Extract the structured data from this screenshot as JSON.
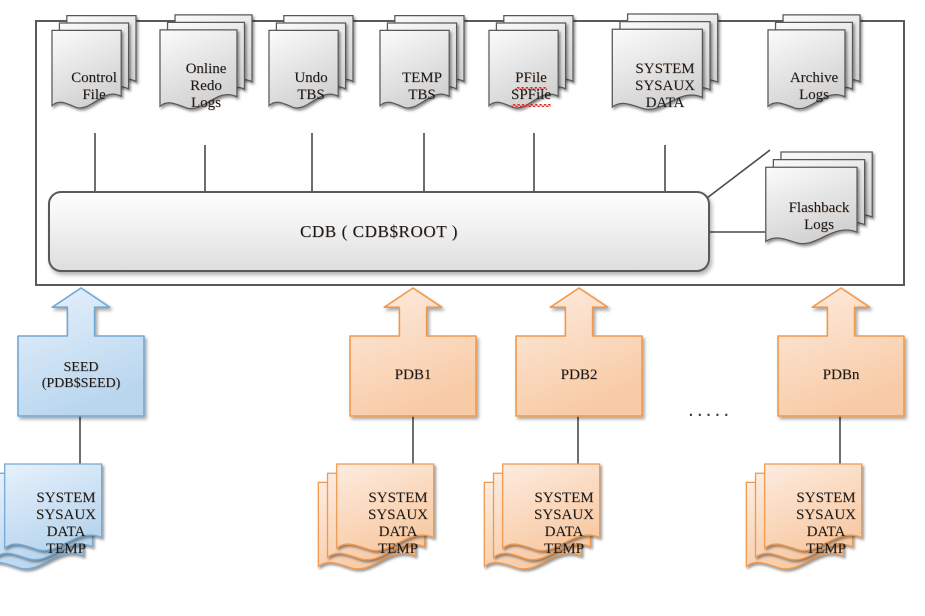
{
  "diagram": {
    "title": "Oracle Multitenant CDB Architecture",
    "colors": {
      "gray_fill_light": "#fbfbfb",
      "gray_fill_dark": "#d2d2d2",
      "gray_stroke": "#595959",
      "blue_fill_light": "#e8f1fb",
      "blue_fill_dark": "#b9d6ef",
      "blue_stroke": "#6fa8d6",
      "orange_fill_light": "#fdece0",
      "orange_fill_dark": "#f8cba6",
      "orange_stroke": "#f0994e",
      "container_stroke": "#5a5a5a",
      "line_stroke": "#4a4a4a"
    }
  },
  "cdb": {
    "root_label": "CDB ( CDB$ROOT )",
    "top_files": [
      {
        "id": "control-file",
        "lines": [
          "Control",
          "File"
        ],
        "misspelled": []
      },
      {
        "id": "online-redo-logs",
        "lines": [
          "Online",
          "Redo",
          "Logs"
        ],
        "misspelled": []
      },
      {
        "id": "undo-tbs",
        "lines": [
          "Undo",
          "TBS"
        ],
        "misspelled": []
      },
      {
        "id": "temp-tbs",
        "lines": [
          "TEMP",
          "TBS"
        ],
        "misspelled": []
      },
      {
        "id": "pfile-spfile",
        "lines": [
          "PFile",
          "SPFile"
        ],
        "misspelled": [
          "PFile",
          "SPFile"
        ]
      },
      {
        "id": "system-sysaux-data",
        "lines": [
          "SYSTEM",
          "SYSAUX",
          "DATA"
        ],
        "misspelled": []
      },
      {
        "id": "archive-logs",
        "lines": [
          "Archive",
          "Logs"
        ],
        "misspelled": []
      }
    ],
    "side_files": [
      {
        "id": "flashback-logs",
        "lines": [
          "Flashback",
          "Logs"
        ],
        "misspelled": []
      }
    ]
  },
  "containers": [
    {
      "id": "seed",
      "kind": "seed",
      "color": "blue",
      "lines": [
        "SEED",
        "(PDB$SEED)"
      ],
      "tablespaces": [
        "SYSTEM",
        "SYSAUX",
        "DATA",
        "TEMP"
      ]
    },
    {
      "id": "pdb1",
      "kind": "pdb",
      "color": "orange",
      "lines": [
        "PDB1"
      ],
      "tablespaces": [
        "SYSTEM",
        "SYSAUX",
        "DATA",
        "TEMP"
      ]
    },
    {
      "id": "pdb2",
      "kind": "pdb",
      "color": "orange",
      "lines": [
        "PDB2"
      ],
      "tablespaces": [
        "SYSTEM",
        "SYSAUX",
        "DATA",
        "TEMP"
      ]
    },
    {
      "id": "pdbn",
      "kind": "pdb",
      "color": "orange",
      "lines": [
        "PDBn"
      ],
      "tablespaces": [
        "SYSTEM",
        "SYSAUX",
        "DATA",
        "TEMP"
      ]
    }
  ],
  "ellipsis": {
    "text": "....."
  }
}
